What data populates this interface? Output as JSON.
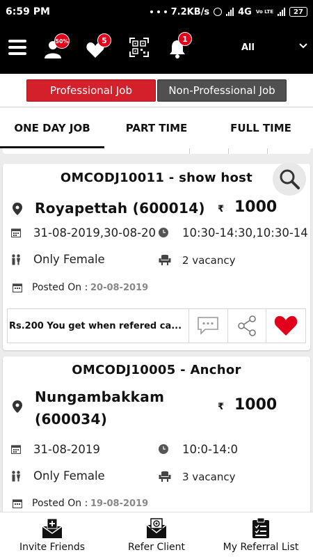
{
  "status_bar": {
    "time": "6:59 PM",
    "speed": "7.2KB/s",
    "network": "4G",
    "volte": "Vo LTE",
    "battery": "27"
  },
  "header": {
    "profile_badge": "50%",
    "wishlist_badge": "5",
    "notification_badge": "1",
    "filter_label": "All",
    "icons": [
      "menu-icon",
      "profile-icon",
      "heart-icon",
      "qr-code-icon",
      "bell-icon",
      "chevron-down-icon"
    ]
  },
  "job_type_toggle": {
    "active": "Professional Job",
    "inactive": "Non-Professional Job",
    "active_color": "#d3202b",
    "inactive_color": "#505050"
  },
  "tabs": [
    {
      "label": "ONE DAY JOB",
      "active": true
    },
    {
      "label": "PART TIME"
    },
    {
      "label": "FULL TIME"
    }
  ],
  "jobs": [
    {
      "title": "OMCODJ10011 - show host",
      "location": "Royapettah (600014)",
      "currency": "₹",
      "amount": "1000",
      "dates": "31-08-2019,30-08-20",
      "time": "10:30-14:30,10:30-14",
      "gender": "Only Female",
      "vacancy": "2 vacancy",
      "posted_label": "Posted On :",
      "posted_date": "20-08-2019",
      "referral_text": "Rs.200 You get when refered ca...",
      "favorite_color": "#e2001a"
    },
    {
      "title": "OMCODJ10005 - Anchor",
      "location_line1": "Nungambakkam",
      "location_line2": "(600034)",
      "currency": "₹",
      "amount": "1000",
      "dates": "31-08-2019",
      "time": "10:0-14:0",
      "gender": "Only Female",
      "vacancy": "3 vacancy",
      "posted_label": "Posted On :",
      "posted_date": "19-08-2019"
    }
  ],
  "bottom_nav": [
    {
      "label": "Invite Friends",
      "icon": "invite-envelope-icon"
    },
    {
      "label": "Refer Client",
      "icon": "refer-envelope-icon"
    },
    {
      "label": "My Referral List",
      "icon": "clipboard-list-icon"
    }
  ]
}
